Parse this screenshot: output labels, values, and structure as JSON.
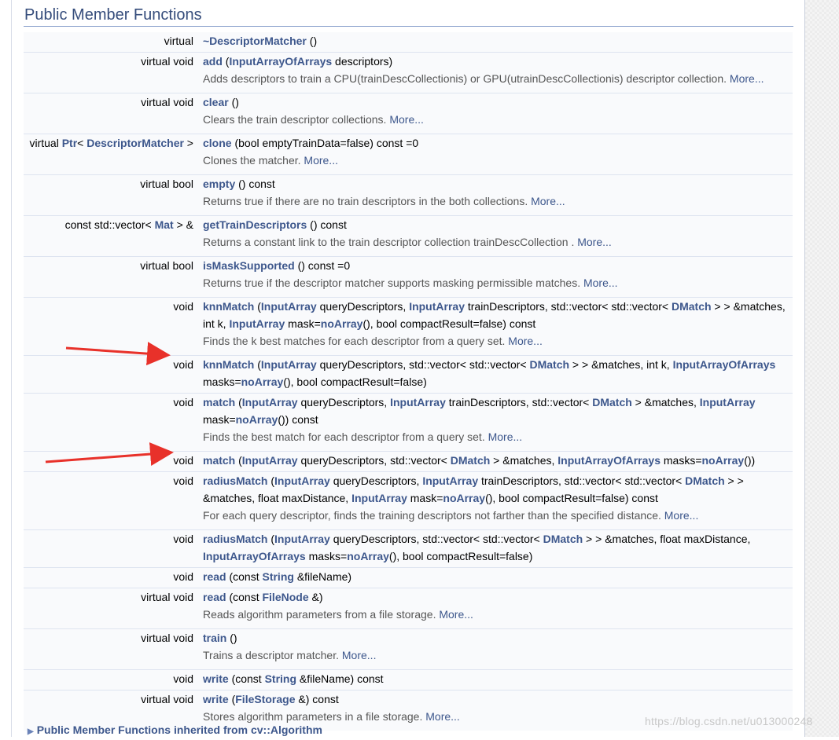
{
  "section_title": "Public Member Functions",
  "rows": [
    {
      "id": "destructor",
      "left": "virtual",
      "sig": "~DescriptorMatcher",
      "args": " ()",
      "desc": null
    },
    {
      "id": "add",
      "left": "virtual void",
      "sig": "add",
      "args_parts": [
        " (",
        {
          "link": "InputArrayOfArrays"
        },
        " descriptors)"
      ],
      "desc": "Adds descriptors to train a CPU(trainDescCollectionis) or GPU(utrainDescCollectionis) descriptor collection. ",
      "more": "More..."
    },
    {
      "id": "clear",
      "left": "virtual void",
      "sig": "clear",
      "args": " ()",
      "desc": "Clears the train descriptor collections. ",
      "more": "More..."
    },
    {
      "id": "clone",
      "left_parts": [
        "virtual ",
        {
          "link": "Ptr"
        },
        "< ",
        {
          "link": "DescriptorMatcher"
        },
        " >"
      ],
      "sig": "clone",
      "args": " (bool emptyTrainData=false) const =0",
      "desc": "Clones the matcher. ",
      "more": "More..."
    },
    {
      "id": "empty",
      "left": "virtual bool",
      "sig": "empty",
      "args": " () const",
      "desc": "Returns true if there are no train descriptors in the both collections. ",
      "more": "More..."
    },
    {
      "id": "getTrainDescriptors",
      "left_parts": [
        "const std::vector< ",
        {
          "link": "Mat"
        },
        " > &"
      ],
      "sig": "getTrainDescriptors",
      "args": " () const",
      "desc": "Returns a constant link to the train descriptor collection trainDescCollection . ",
      "more": "More..."
    },
    {
      "id": "isMaskSupported",
      "left": "virtual bool",
      "sig": "isMaskSupported",
      "args": " () const =0",
      "desc": "Returns true if the descriptor matcher supports masking permissible matches. ",
      "more": "More..."
    }
  ],
  "knn1": {
    "left": "void",
    "sig": "knnMatch",
    "l1": [
      " (",
      {
        "link": "InputArray"
      },
      " queryDescriptors, ",
      {
        "link": "InputArray"
      },
      " trainDescriptors, std::vector< std::vector< ",
      {
        "link": "DMatch"
      },
      " > > &matches,"
    ],
    "l2": [
      "int k, ",
      {
        "link": "InputArray"
      },
      " mask=",
      {
        "link": "noArray"
      },
      "(), bool compactResult=false) const"
    ],
    "desc": "Finds the k best matches for each descriptor from a query set. ",
    "more": "More..."
  },
  "knn2": {
    "left": "void",
    "sig": "knnMatch",
    "l1": [
      " (",
      {
        "link": "InputArray"
      },
      " queryDescriptors, std::vector< std::vector< ",
      {
        "link": "DMatch"
      },
      " > > &matches, int k, ",
      {
        "link": "InputArrayOfArrays"
      }
    ],
    "l2": [
      "masks=",
      {
        "link": "noArray"
      },
      "(), bool compactResult=false)"
    ]
  },
  "match1": {
    "left": "void",
    "sig": "match",
    "l1": [
      " (",
      {
        "link": "InputArray"
      },
      " queryDescriptors, ",
      {
        "link": "InputArray"
      },
      " trainDescriptors, std::vector< ",
      {
        "link": "DMatch"
      },
      " > &matches, ",
      {
        "link": "InputArray"
      }
    ],
    "l2": [
      "mask=",
      {
        "link": "noArray"
      },
      "()) const"
    ],
    "desc": "Finds the best match for each descriptor from a query set. ",
    "more": "More..."
  },
  "match2": {
    "left": "void",
    "sig": "match",
    "l1": [
      " (",
      {
        "link": "InputArray"
      },
      " queryDescriptors, std::vector< ",
      {
        "link": "DMatch"
      },
      " > &matches, ",
      {
        "link": "InputArrayOfArrays"
      },
      " masks=",
      {
        "link": "noArray"
      },
      "())"
    ]
  },
  "radius1": {
    "left": "void",
    "sig": "radiusMatch",
    "l1": [
      " (",
      {
        "link": "InputArray"
      },
      " queryDescriptors, ",
      {
        "link": "InputArray"
      },
      " trainDescriptors, std::vector< std::vector< ",
      {
        "link": "DMatch"
      },
      " > >"
    ],
    "l2": [
      "&matches, float maxDistance, ",
      {
        "link": "InputArray"
      },
      " mask=",
      {
        "link": "noArray"
      },
      "(), bool compactResult=false) const"
    ],
    "desc": "For each query descriptor, finds the training descriptors not farther than the specified distance. ",
    "more": "More..."
  },
  "radius2": {
    "left": "void",
    "sig": "radiusMatch",
    "l1": [
      " (",
      {
        "link": "InputArray"
      },
      " queryDescriptors, std::vector< std::vector< ",
      {
        "link": "DMatch"
      },
      " > > &matches, float maxDistance,"
    ],
    "l2": [
      {
        "link": "InputArrayOfArrays"
      },
      " masks=",
      {
        "link": "noArray"
      },
      "(), bool compactResult=false)"
    ]
  },
  "tail_rows": [
    {
      "id": "read1",
      "left": "void",
      "sig": "read",
      "args_parts": [
        " (const ",
        {
          "link": "String"
        },
        " &fileName)"
      ],
      "desc": null
    },
    {
      "id": "read2",
      "left": "virtual void",
      "sig": "read",
      "args_parts": [
        " (const ",
        {
          "link": "FileNode"
        },
        " &)"
      ],
      "desc": "Reads algorithm parameters from a file storage. ",
      "more": "More..."
    },
    {
      "id": "train",
      "left": "virtual void",
      "sig": "train",
      "args": " ()",
      "desc": "Trains a descriptor matcher. ",
      "more": "More..."
    },
    {
      "id": "write1",
      "left": "void",
      "sig": "write",
      "args_parts": [
        " (const ",
        {
          "link": "String"
        },
        " &fileName) const"
      ],
      "desc": null
    },
    {
      "id": "write2",
      "left": "virtual void",
      "sig": "write",
      "args_parts": [
        " (",
        {
          "link": "FileStorage"
        },
        " &) const"
      ],
      "desc": "Stores algorithm parameters in a file storage. ",
      "more": "More..."
    }
  ],
  "footer": {
    "text": "Public Member Functions inherited from ",
    "link": "cv::Algorithm"
  },
  "watermark": "https://blog.csdn.net/u013000248",
  "colors": {
    "link": "#3d578c",
    "arrow": "#e8312a",
    "header": "#354c7b"
  }
}
